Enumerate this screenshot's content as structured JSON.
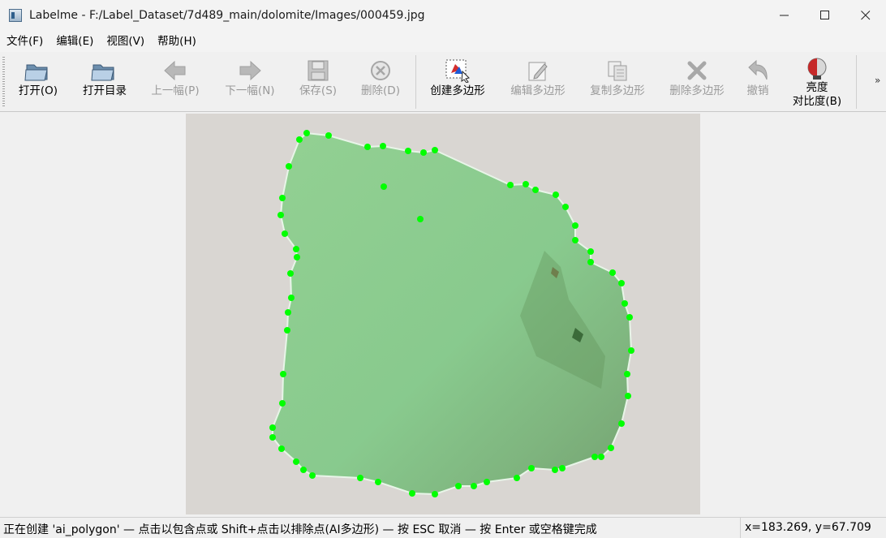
{
  "window": {
    "title": "Labelme - F:/Label_Dataset/7d489_main/dolomite/Images/000459.jpg",
    "controls": {
      "minimize": "—",
      "maximize": "☐",
      "close": "✕"
    }
  },
  "menu": {
    "items": [
      {
        "label": "文件(F)"
      },
      {
        "label": "编辑(E)"
      },
      {
        "label": "视图(V)"
      },
      {
        "label": "帮助(H)"
      }
    ]
  },
  "toolbar": {
    "tools": [
      {
        "label": "打开(O)",
        "icon": "folder-open-icon",
        "enabled": true
      },
      {
        "label": "打开目录",
        "icon": "folder-open-icon",
        "enabled": true
      },
      {
        "label": "上一幅(P)",
        "icon": "arrow-left-icon",
        "enabled": false
      },
      {
        "label": "下一幅(N)",
        "icon": "arrow-right-icon",
        "enabled": false
      },
      {
        "label": "保存(S)",
        "icon": "floppy-disk-icon",
        "enabled": false
      },
      {
        "label": "删除(D)",
        "icon": "delete-circle-icon",
        "enabled": false
      },
      {
        "label": "创建多边形",
        "icon": "create-polygon-icon",
        "enabled": true
      },
      {
        "label": "编辑多边形",
        "icon": "edit-polygon-icon",
        "enabled": false
      },
      {
        "label": "复制多边形",
        "icon": "copy-polygon-icon",
        "enabled": false
      },
      {
        "label": "删除多边形",
        "icon": "delete-polygon-icon",
        "enabled": false
      },
      {
        "label": "撤销",
        "icon": "undo-icon",
        "enabled": false
      },
      {
        "label": "亮度\n对比度(B)",
        "icon": "brightness-contrast-icon",
        "enabled": true
      }
    ],
    "overflow": "»"
  },
  "canvas": {
    "polygon_fill": "#7fd37f",
    "point_color": "#00ff00",
    "frame_color": "#d9d6d2"
  },
  "status": {
    "message": "正在创建 'ai_polygon' — 点击以包含点或 Shift+点击以排除点(AI多边形) — 按 ESC 取消 — 按 Enter 或空格键完成",
    "coords": "x=183.269, y=67.709"
  }
}
